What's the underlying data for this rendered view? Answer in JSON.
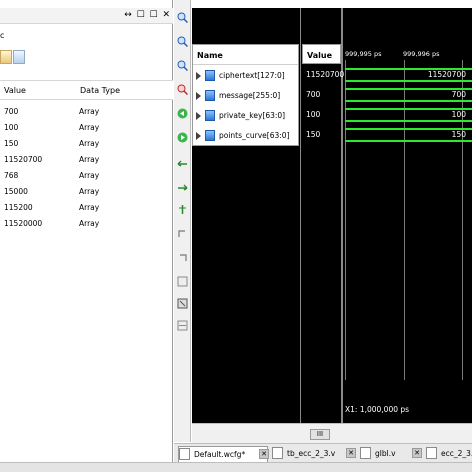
{
  "left_panel": {
    "window_controls": "↔ ☐ ☐ ✕",
    "breadcrumb": "c",
    "columns": {
      "value": "Value",
      "data_type": "Data Type"
    },
    "rows": [
      {
        "value": "700",
        "type": "Array"
      },
      {
        "value": "100",
        "type": "Array"
      },
      {
        "value": "150",
        "type": "Array"
      },
      {
        "value": "11520700",
        "type": "Array"
      },
      {
        "value": "768",
        "type": "Array"
      },
      {
        "value": "15000",
        "type": "Array"
      },
      {
        "value": "115200",
        "type": "Array"
      },
      {
        "value": "11520000",
        "type": "Array"
      }
    ]
  },
  "wave": {
    "name_header": "Name",
    "value_header": "Value",
    "signals": [
      {
        "name": "ciphertext[127:0]",
        "value": "11520700",
        "wave_label": "11520700"
      },
      {
        "name": "message[255:0]",
        "value": "700",
        "wave_label": "700"
      },
      {
        "name": "private_key[63:0]",
        "value": "100",
        "wave_label": "100"
      },
      {
        "name": "points_curve[63:0]",
        "value": "150",
        "wave_label": "150"
      }
    ],
    "ruler_ticks": [
      "999,995 ps",
      "999,996 ps"
    ],
    "cursor_readout": "X1: 1,000,000 ps",
    "colors": {
      "trace": "#2ee82e",
      "background": "#000000"
    }
  },
  "tabs": [
    {
      "label": "Default.wcfg*",
      "icon": "wave-config-icon"
    },
    {
      "label": "tb_ecc_2_3.v",
      "icon": "verilog-file-icon"
    },
    {
      "label": "glbl.v",
      "icon": "verilog-file-icon"
    },
    {
      "label": "ecc_2_3...",
      "icon": "verilog-file-icon"
    }
  ],
  "scroll_thumb": "III"
}
